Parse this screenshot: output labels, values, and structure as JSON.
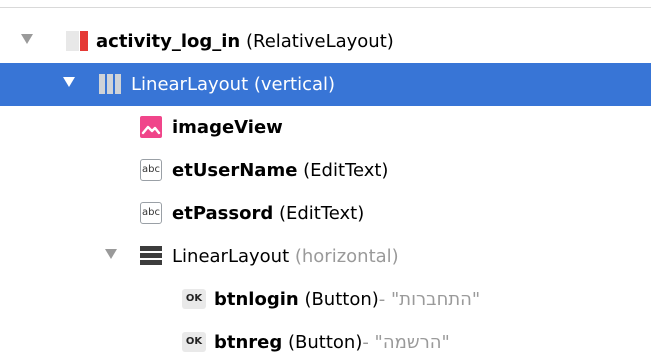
{
  "tree": {
    "items": [
      {
        "icon": "relative-layout-icon",
        "name": "activity_log_in",
        "type": " (RelativeLayout)",
        "expanded": true
      },
      {
        "icon": "linear-layout-vertical-icon",
        "name": "LinearLayout",
        "type": " (vertical)",
        "expanded": true,
        "selected": true
      },
      {
        "icon": "image-view-icon",
        "name": "imageView",
        "type": ""
      },
      {
        "icon": "edit-text-icon",
        "icon_text": "abc",
        "name": "etUserName",
        "type": " (EditText)"
      },
      {
        "icon": "edit-text-icon",
        "icon_text": "abc",
        "name": "etPassord",
        "type": " (EditText)"
      },
      {
        "icon": "linear-layout-horizontal-icon",
        "name": "LinearLayout",
        "type": " (horizontal)",
        "expanded": true
      },
      {
        "icon": "button-icon",
        "icon_text": "OK",
        "name": "btnlogin",
        "type": " (Button)",
        "text": "\"התחברות\" -"
      },
      {
        "icon": "button-icon",
        "icon_text": "OK",
        "name": "btnreg",
        "type": " (Button)",
        "text": "\"הרשמה\" -"
      }
    ]
  },
  "colors": {
    "selection": "#3875d6",
    "relative_icon": "#e53935",
    "image_icon": "#f0458a"
  }
}
